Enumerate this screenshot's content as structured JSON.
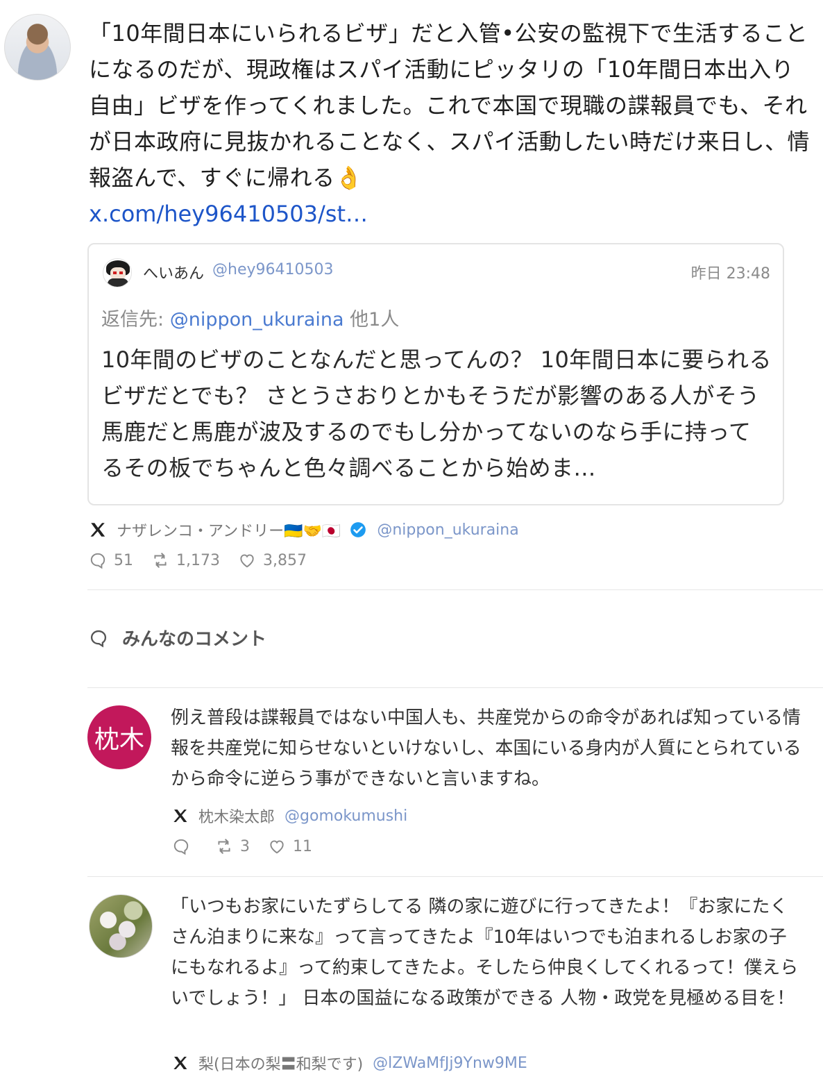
{
  "post": {
    "text": "「10年間日本にいられるビザ」だと入管•公安の監視下で生活することになるのだが、現政権はスパイ活動にピッタリの「10年間日本出入り自由」ビザを作ってくれました。これで本国で現職の諜報員でも、それが日本政府に見抜かれることなく、スパイ活動したい時だけ来日し、情報盗んで、すぐに帰れる👌",
    "link": "x.com/hey96410503/st…",
    "quote": {
      "name": "へいあん",
      "handle": "@hey96410503",
      "time": "昨日 23:48",
      "reply_prefix": "返信先:",
      "reply_mention": "@nippon_ukuraina",
      "reply_suffix": "他1人",
      "body": "10年間のビザのことなんだと思ってんの？ 10年間日本に要られるビザだとでも？ さとうさおりとかもそうだが影響のある人がそう馬鹿だと馬鹿が波及するのでもし分かってないのなら手に持ってるその板でちゃんと色々調べることから始めま…"
    },
    "source": {
      "name": "ナザレンコ・アンドリー🇺🇦🤝🇯🇵",
      "handle": "@nippon_ukuraina"
    },
    "stats": {
      "replies": "51",
      "retweets": "1,173",
      "likes": "3,857"
    }
  },
  "comments_section": {
    "title": "みんなのコメント"
  },
  "comments": [
    {
      "avatar_text": "枕木",
      "text": "例え普段は諜報員ではない中国人も、共産党からの命令があれば知っている情報を共産党に知らせないといけないし、本国にいる身内が人質にとられているから命令に逆らう事ができないと言いますね。",
      "name": "枕木染太郎",
      "handle": "@gomokumushi",
      "retweets": "3",
      "likes": "11"
    },
    {
      "text": "「いつもお家にいたずらしてる 隣の家に遊びに行ってきたよ！『お家にたくさん泊まりに来な』って言ってきたよ『10年はいつでも泊まれるしお家の子にもなれるよ』って約束してきたよ。そしたら仲良くしてくれるって！僕えらいでしょう！」 日本の国益になる政策ができる 人物・政党を見極める目を！",
      "name": "梨(日本の梨〓和梨です)",
      "handle": "@lZWaMfJj9Ynw9ME"
    }
  ],
  "colors": {
    "link": "#1d55c8",
    "handle": "#7b96c9",
    "avatar_red": "#c2185b",
    "verified": "#1d9bf0"
  }
}
